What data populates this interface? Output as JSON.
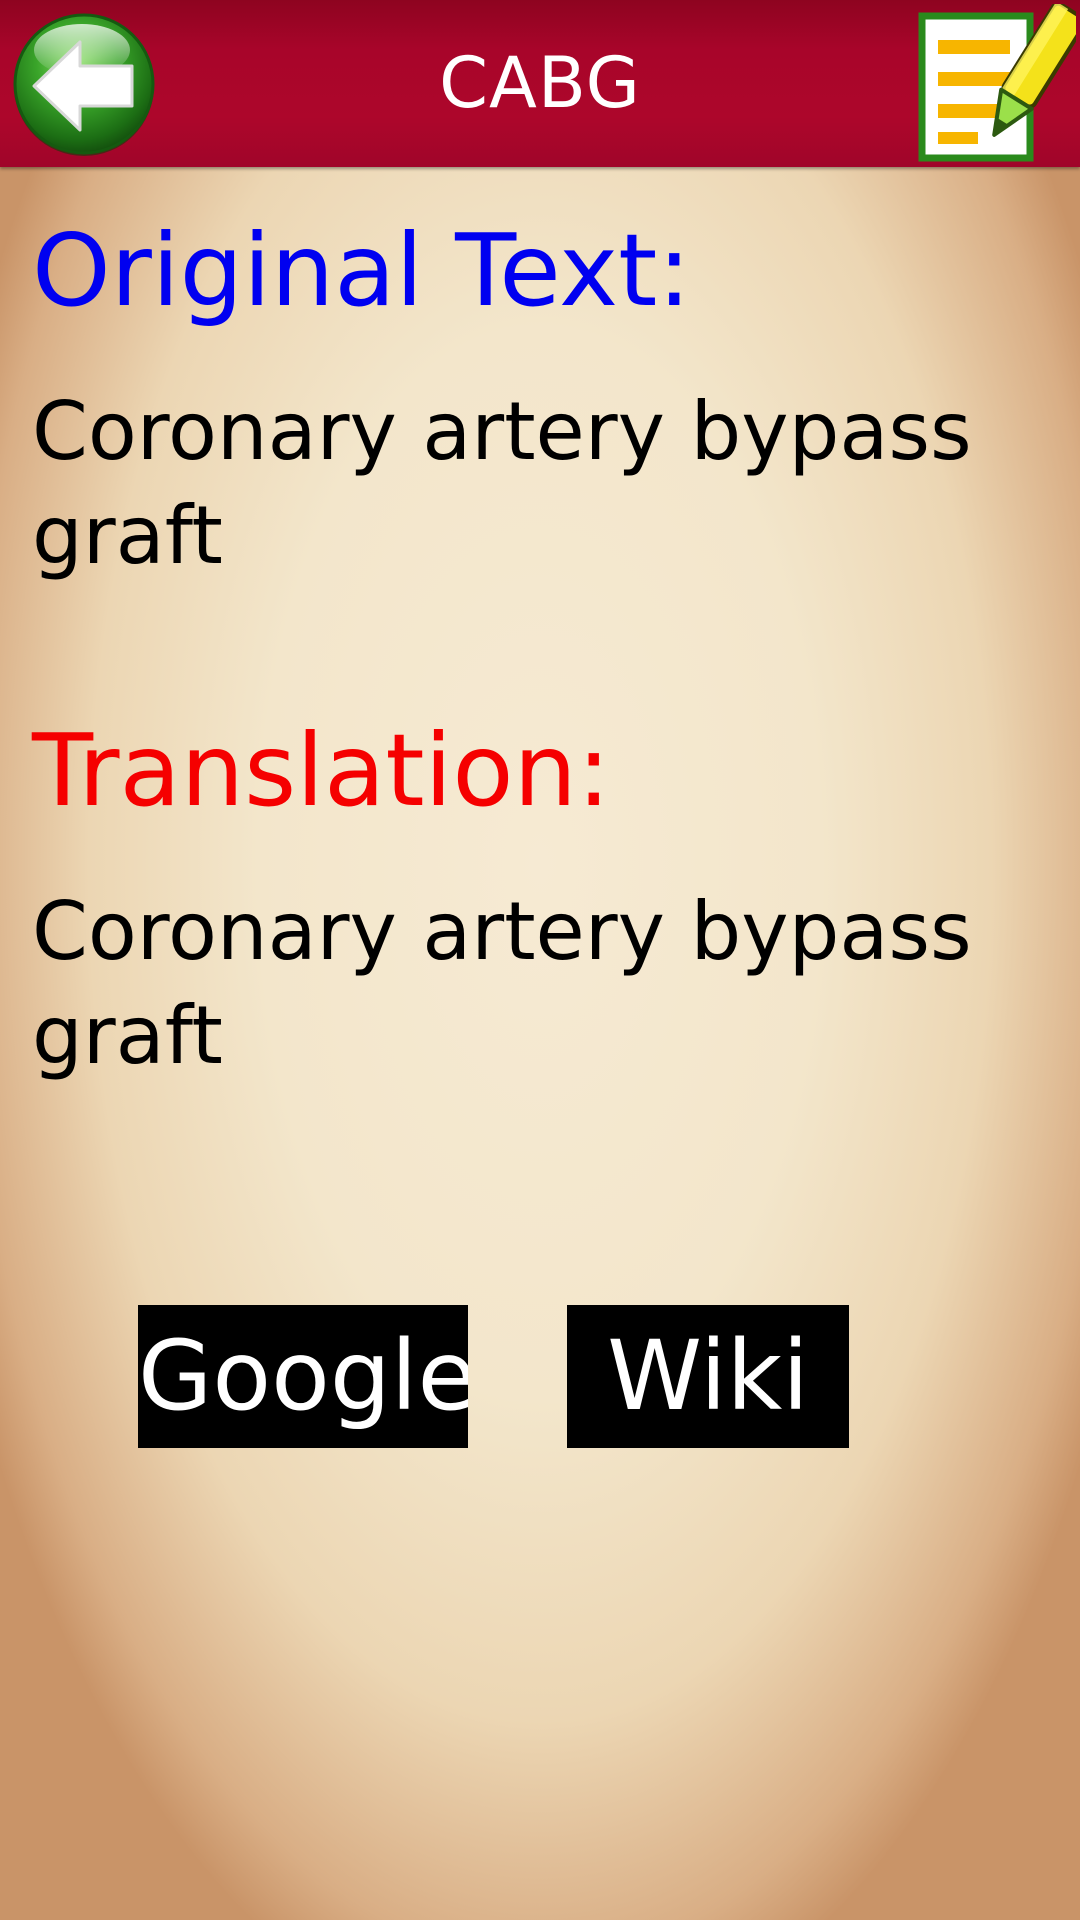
{
  "header": {
    "title": "CABG",
    "back_icon": "back-arrow-icon",
    "notes_icon": "notepad-pencil-icon"
  },
  "original": {
    "heading": "Original Text:",
    "text": "Coronary artery bypass graft"
  },
  "translation": {
    "heading": "Translation:",
    "text": "Coronary artery bypass graft"
  },
  "buttons": {
    "google_label": "Google",
    "wiki_label": "Wiki"
  },
  "colors": {
    "header_bg": "#a8052a",
    "original_heading": "#0000f0",
    "translation_heading": "#f50000",
    "button_bg": "#000000",
    "button_text": "#ffffff"
  }
}
